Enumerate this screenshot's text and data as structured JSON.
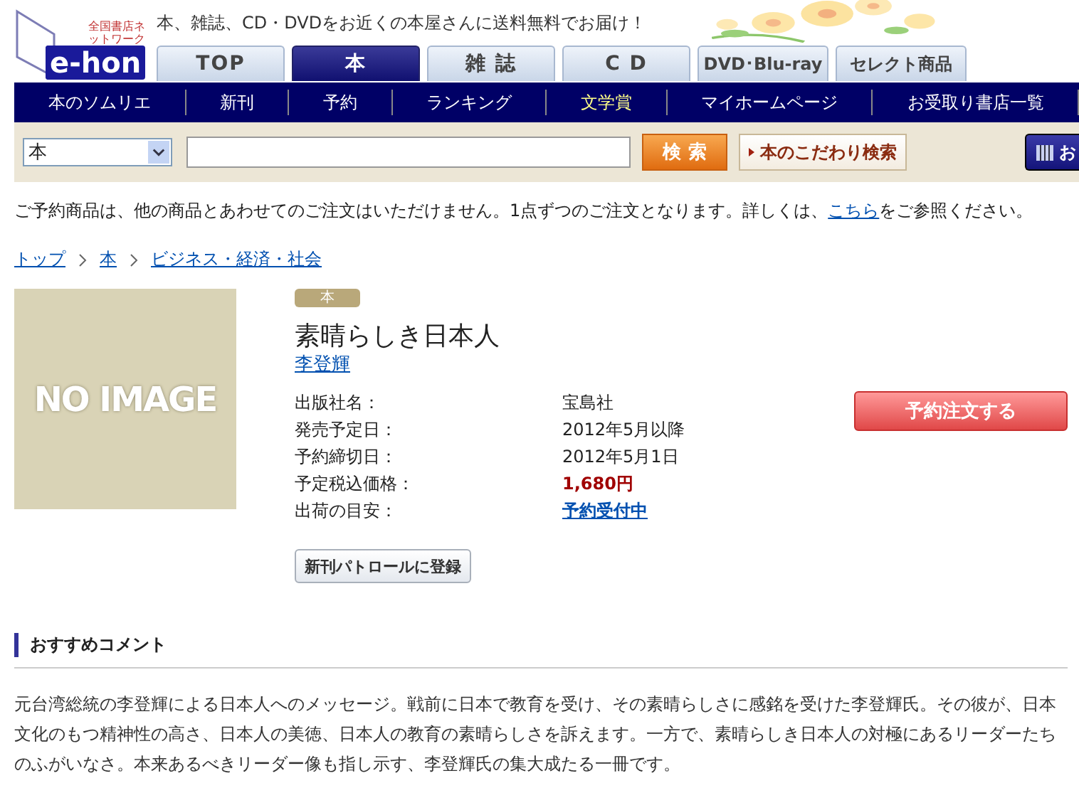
{
  "logo": {
    "tagline": "全国書店ネットワーク",
    "name": "e-hon"
  },
  "header": {
    "message": "本、雑誌、CD・DVDをお近くの本屋さんに送料無料でお届け！"
  },
  "tabs": [
    {
      "label": "TOP",
      "selected": false
    },
    {
      "label": "本",
      "selected": true
    },
    {
      "label": "雑 誌",
      "selected": false
    },
    {
      "label": "C D",
      "selected": false
    },
    {
      "label": "DVD･Blu-ray",
      "selected": false
    },
    {
      "label": "セレクト商品",
      "selected": false
    }
  ],
  "nav": [
    {
      "label": "本のソムリエ",
      "highlighted": false
    },
    {
      "label": "新刊",
      "highlighted": false
    },
    {
      "label": "予約",
      "highlighted": false
    },
    {
      "label": "ランキング",
      "highlighted": false
    },
    {
      "label": "文学賞",
      "highlighted": true
    },
    {
      "label": "マイホームページ",
      "highlighted": false
    },
    {
      "label": "お受取り書店一覧",
      "highlighted": false
    }
  ],
  "search": {
    "category": "本",
    "search_button": "検 索",
    "advanced_button": "本のこだわり検索",
    "side_button": "お"
  },
  "notice": {
    "before": "ご予約商品は、他の商品とあわせてのご注文はいただけません。1点ずつのご注文となります。詳しくは、",
    "link": "こちら",
    "after": "をご参照ください。"
  },
  "breadcrumb": [
    "トップ",
    "本",
    "ビジネス・経済・社会"
  ],
  "product": {
    "cover_placeholder": "NO IMAGE",
    "badge": "本",
    "title": "素晴らしき日本人",
    "author": "李登輝",
    "details": [
      {
        "label": "出版社名：",
        "value": "宝島社",
        "kind": "plain"
      },
      {
        "label": "発売予定日：",
        "value": "2012年5月以降",
        "kind": "plain"
      },
      {
        "label": "予約締切日：",
        "value": "2012年5月1日",
        "kind": "plain"
      },
      {
        "label": "予定税込価格：",
        "value": "1,680円",
        "kind": "price"
      },
      {
        "label": "出荷の目安：",
        "value": "予約受付中",
        "kind": "link"
      }
    ],
    "order_button": "予約注文する",
    "patrol_button": "新刊パトロールに登録"
  },
  "recommend": {
    "heading": "おすすめコメント",
    "text": "元台湾総統の李登輝による日本人へのメッセージ。戦前に日本で教育を受け、その素晴らしさに感銘を受けた李登輝氏。その彼が、日本文化のもつ精神性の高さ、日本人の美徳、日本人の教育の素晴らしさを訴えます。一方で、素晴らしき日本人の対極にあるリーダーたちのふがいなさ。本来あるべきリーダー像も指し示す、李登輝氏の集大成たる一冊です。"
  }
}
